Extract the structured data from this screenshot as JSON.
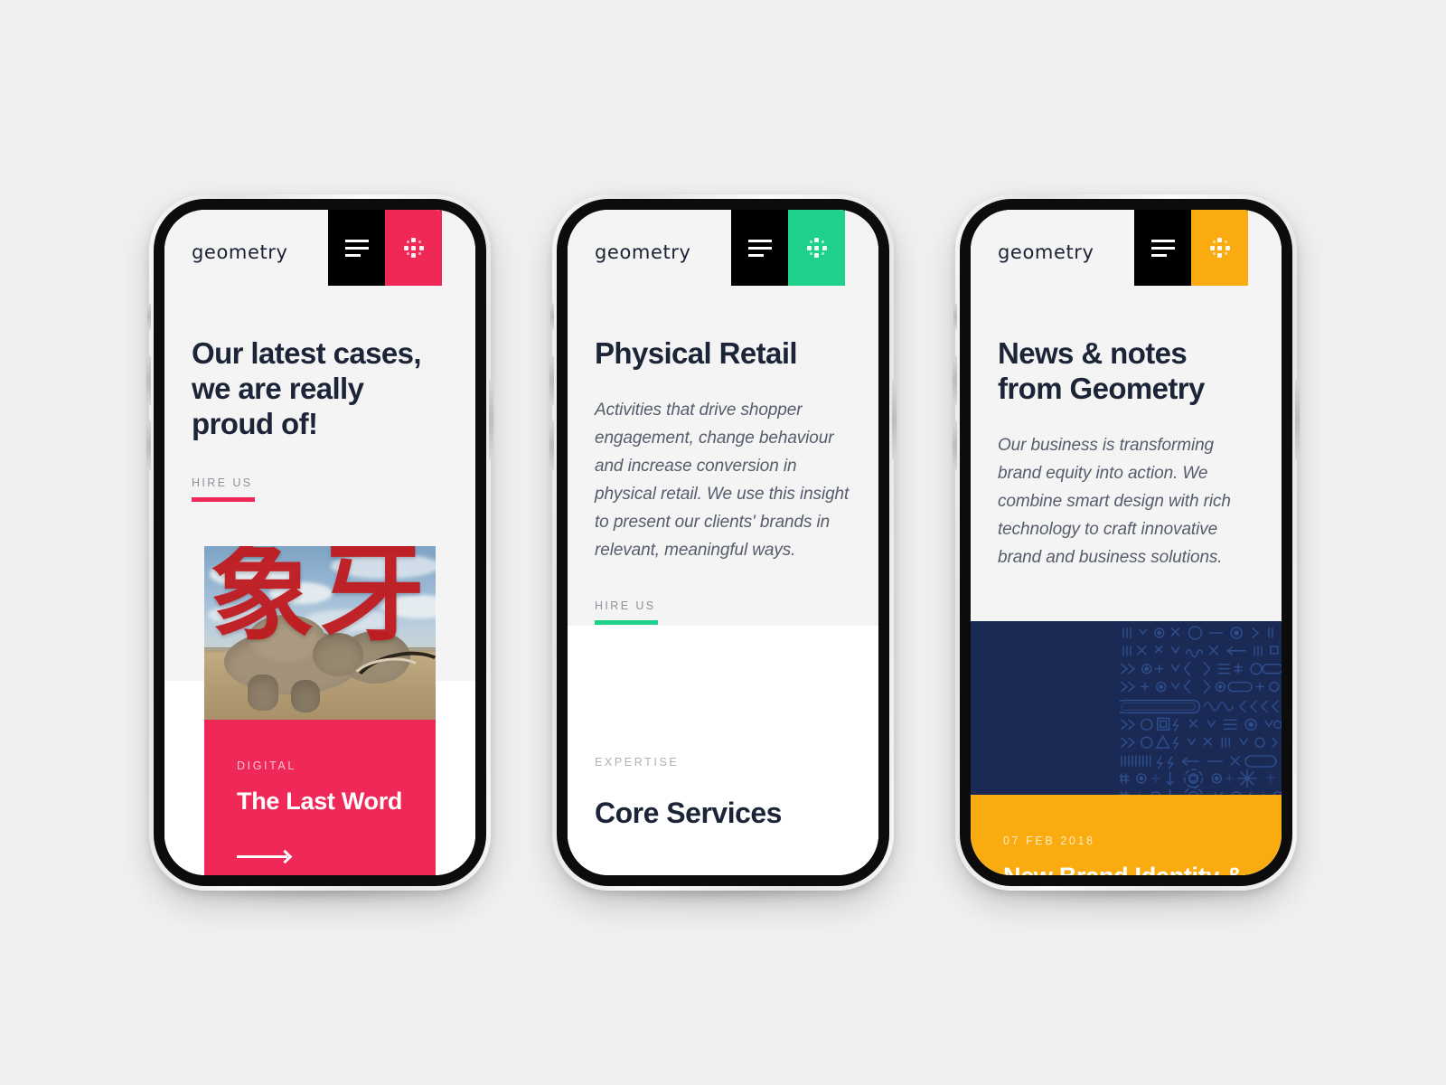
{
  "scene": {
    "background_color": "#f0f0f0",
    "device_count": 3
  },
  "brand": {
    "name": "geometry",
    "colors": {
      "pink": "#f02857",
      "green": "#1fd08a",
      "yellow": "#f9ab10",
      "navy": "#1c2438",
      "navy_card": "#1b2a54",
      "black": "#000000",
      "text_muted": "#8d9199",
      "screen_bg": "#f4f4f4"
    }
  },
  "icons": {
    "menu": "hamburger-icon",
    "grid": "dot-diamond-icon",
    "arrow": "arrow-right-icon"
  },
  "screens": [
    {
      "id": "cases",
      "accent": "#f02857",
      "header": {
        "logo": "geometry",
        "menu_label": "Menu",
        "grid_label": "Grid"
      },
      "title": "Our latest cases, we are really proud of!",
      "lede": "",
      "cta": {
        "label": "HIRE US"
      },
      "card": {
        "kicker": "DIGITAL",
        "title": "The Last Word",
        "media_alt": "Elephant on savanna with red Chinese characters",
        "media_overlay_text": "象牙",
        "has_arrow": true,
        "bg": "#f02857"
      }
    },
    {
      "id": "physical-retail",
      "accent": "#1fd08a",
      "header": {
        "logo": "geometry",
        "menu_label": "Menu",
        "grid_label": "Grid"
      },
      "title": "Physical Retail",
      "lede": "Activities that drive shopper engagement, change behaviour and increase conversion in physical retail. We use this insight to present our clients' brands in relevant, meaningful ways.",
      "cta": {
        "label": "HIRE US"
      },
      "section": {
        "kicker": "EXPERTISE",
        "heading": "Core Services"
      }
    },
    {
      "id": "news",
      "accent": "#f9ab10",
      "header": {
        "logo": "geometry",
        "menu_label": "Menu",
        "grid_label": "Grid"
      },
      "title": "News & notes from Geometry",
      "lede": "Our business is transforming brand equity into action. We combine smart design with rich technology to craft innovative brand and business solutions.",
      "cta": null,
      "card": {
        "kicker": "07 FEB 2018",
        "title": "New Brand Identity & Logo",
        "media_alt": "Navy panel with line-art icon pattern",
        "has_arrow": false,
        "bg": "#f9ab10"
      }
    }
  ]
}
